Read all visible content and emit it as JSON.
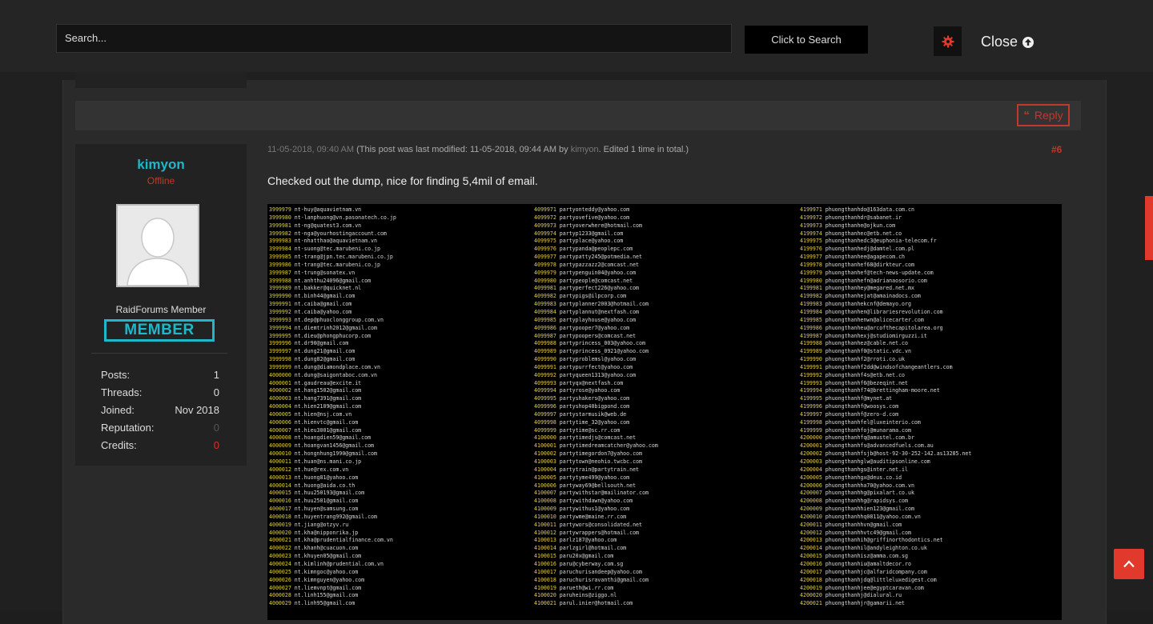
{
  "searchbar": {
    "placeholder": "Search...",
    "button_label": "Click to Search",
    "close_label": "Close"
  },
  "post": {
    "reply_label": "Reply",
    "timestamp": "11-05-2018, 09:40 AM",
    "modified_note": "(This post was last modified: 11-05-2018, 09:44 AM by",
    "modified_by": "kimyon",
    "edited_note": ". Edited 1 time in total.)",
    "number": "#6",
    "text": "Checked out the dump, nice for finding 5,4mil of email."
  },
  "user": {
    "name": "kimyon",
    "status": "Offline",
    "rank_title": "RaidForums Member",
    "rank_badge": "MEMBER",
    "stats": [
      {
        "label": "Posts:",
        "value": "1"
      },
      {
        "label": "Threads:",
        "value": "0"
      },
      {
        "label": "Joined:",
        "value": "Nov 2018"
      },
      {
        "label": "Reputation:",
        "value": "0"
      },
      {
        "label": "Credits:",
        "value": "0"
      }
    ]
  },
  "dump": {
    "columns": [
      [
        [
          "3999979",
          "nt-huy@aquavietnam.vn"
        ],
        [
          "3999980",
          "nt-lanphuong@vn.pasonatech.co.jp"
        ],
        [
          "3999981",
          "nt-ng@quatest3.com.vn"
        ],
        [
          "3999982",
          "nt-nga@yourhostingaccount.com"
        ],
        [
          "3999983",
          "nt-nhatthao@aquavietnam.vn"
        ],
        [
          "3999984",
          "nt-suong@tec.marubeni.co.jp"
        ],
        [
          "3999985",
          "nt-trang@jpn.tec.marubeni.co.jp"
        ],
        [
          "3999986",
          "nt-trang@tec.marubeni.co.jp"
        ],
        [
          "3999987",
          "nt-trung@sonatex.vn"
        ],
        [
          "3999988",
          "nt.anhthu24096@gmail.com"
        ],
        [
          "3999989",
          "nt.bakker@quicknet.nl"
        ],
        [
          "3999990",
          "nt.binh44@gmail.com"
        ],
        [
          "3999991",
          "nt.caiba@gmail.com"
        ],
        [
          "3999992",
          "nt.caiba@yahoo.com"
        ],
        [
          "3999993",
          "nt.dep@phuoclonggroup.com.vn"
        ],
        [
          "3999994",
          "nt.diemtrinh2012@gmail.com"
        ],
        [
          "3999995",
          "nt.dieu@phongphucorp.com"
        ],
        [
          "3999996",
          "nt.dr90@gmail.com"
        ],
        [
          "3999997",
          "nt.dung21@gmail.com"
        ],
        [
          "3999998",
          "nt.dung82@gmail.com"
        ],
        [
          "3999999",
          "nt.dung@diamondplace.com.vn"
        ],
        [
          "4000000",
          "nt.dung@saigontaboc.com.vn"
        ],
        [
          "4000001",
          "nt.gaudreau@excite.it"
        ],
        [
          "4000002",
          "nt.hang1502@gmail.com"
        ],
        [
          "4000003",
          "nt.hang7391@gmail.com"
        ],
        [
          "4000004",
          "nt.hien2109@gmail.com"
        ],
        [
          "4000005",
          "nt.hien@nsj.com.vn"
        ],
        [
          "4000006",
          "nt.hienvtc@gmail.com"
        ],
        [
          "4000007",
          "nt.hieu3001@gmail.com"
        ],
        [
          "4000008",
          "nt.hoangdien59@gmail.com"
        ],
        [
          "4000009",
          "nt.hoangvan1456@gmail.com"
        ],
        [
          "4000010",
          "nt.hongnhung1990@gmail.com"
        ],
        [
          "4000011",
          "nt.huan@ns.mani.co.jp"
        ],
        [
          "4000012",
          "nt.hue@rex.com.vn"
        ],
        [
          "4000013",
          "nt.huong81@yahoo.com"
        ],
        [
          "4000014",
          "nt.huong@aida.co.th"
        ],
        [
          "4000015",
          "nt.huu250193@gmail.com"
        ],
        [
          "4000016",
          "nt.huu2501@gmail.com"
        ],
        [
          "4000017",
          "nt.huyen@samsung.com"
        ],
        [
          "4000018",
          "nt.huyentrang992@gmail.com"
        ],
        [
          "4000019",
          "nt.jiang@otzyv.ru"
        ],
        [
          "4000020",
          "nt.kha@nipponrika.jp"
        ],
        [
          "4000021",
          "nt.kha@prudentialfinance.com.vn"
        ],
        [
          "4000022",
          "nt.khanh@cuacuon.com"
        ],
        [
          "4000023",
          "nt.khuyen05@gmail.com"
        ],
        [
          "4000024",
          "nt.kimlinh@prudential.com.vn"
        ],
        [
          "4000025",
          "nt.kimngoc@yahoo.com"
        ],
        [
          "4000026",
          "nt.kimnguyen@yahoo.com"
        ],
        [
          "4000027",
          "nt.liemvnpt@gmail.com"
        ],
        [
          "4000028",
          "nt.linh155@gmail.com"
        ],
        [
          "4000029",
          "nt.linh95@gmail.com"
        ]
      ],
      [
        [
          "4099971",
          "partyonteddy@yahoo.com"
        ],
        [
          "4099972",
          "partyovefive@yahoo.com"
        ],
        [
          "4099973",
          "partyoverwhere@hotmail.com"
        ],
        [
          "4099974",
          "partyp1233@gmail.com"
        ],
        [
          "4099975",
          "partyplace@yahoo.com"
        ],
        [
          "4099976",
          "partypanda@peoplepc.com"
        ],
        [
          "4099977",
          "partypatty245@potmedia.net"
        ],
        [
          "4099978",
          "partypazzazz2@comcast.net"
        ],
        [
          "4099979",
          "partypenguin04@yahoo.com"
        ],
        [
          "4099980",
          "partypeople@comcast.net"
        ],
        [
          "4099981",
          "partyperfect226@yahoo.com"
        ],
        [
          "4099982",
          "partypigs@ilpcorp.com"
        ],
        [
          "4099983",
          "partyplanner2003@hotmail.com"
        ],
        [
          "4099984",
          "partyplannut@nextfash.com"
        ],
        [
          "4099985",
          "partyplayhouse@yahoo.com"
        ],
        [
          "4099986",
          "partypooper7@yahoo.com"
        ],
        [
          "4099987",
          "partypoopers@comcast.net"
        ],
        [
          "4099988",
          "partyprincess_003@yahoo.com"
        ],
        [
          "4099989",
          "partyprincess_0921@yahoo.com"
        ],
        [
          "4099990",
          "partyproblemsl@yahoo.com"
        ],
        [
          "4099991",
          "partypurrfect@yahoo.com"
        ],
        [
          "4099992",
          "partyqueen1313@yahoo.com"
        ],
        [
          "4099993",
          "partyqx@nextfash.com"
        ],
        [
          "4099994",
          "partyrose@yahoo.com"
        ],
        [
          "4099995",
          "partyshakers@yahoo.com"
        ],
        [
          "4099996",
          "partyshop40bigpond.com"
        ],
        [
          "4099997",
          "partystarmusik@web.de"
        ],
        [
          "4099998",
          "partytime_32@yahoo.com"
        ],
        [
          "4099999",
          "partytime@sc.rr.com"
        ],
        [
          "4100000",
          "partytimedjs@comcast.net"
        ],
        [
          "4100001",
          "partytimedreamcatcher@yahoo.com"
        ],
        [
          "4100002",
          "partytimegordon7@yahoo.com"
        ],
        [
          "4100003",
          "partytown@neohio.twcbc.com"
        ],
        [
          "4100004",
          "partytrain@partytrain.net"
        ],
        [
          "4100005",
          "partytyme499@yahoo.com"
        ],
        [
          "4100006",
          "partyway69@bellsouth.net"
        ],
        [
          "4100007",
          "partywithstar@mailinator.com"
        ],
        [
          "4100008",
          "partywithdawn@yahoo.com"
        ],
        [
          "4100009",
          "partywithus1@yahoo.com"
        ],
        [
          "4100010",
          "partywme@maine.rr.com"
        ],
        [
          "4100011",
          "partywors@consolidated.net"
        ],
        [
          "4100012",
          "partywrappers@hotmail.com"
        ],
        [
          "4100013",
          "parlz187@yahoo.com"
        ],
        [
          "4100014",
          "parlzgirl@hotmail.com"
        ],
        [
          "4100015",
          "paru20x@gmail.com"
        ],
        [
          "4100016",
          "paru@cyberway.com.sg"
        ],
        [
          "4100017",
          "paruchurisandeep@yahoo.com"
        ],
        [
          "4100018",
          "paruchurisravanthi@gmail.com"
        ],
        [
          "4100019",
          "parueth@wi.rr.com"
        ],
        [
          "4100020",
          "paruheins@ziggo.nl"
        ],
        [
          "4100021",
          "parul.inier@hotmail.com"
        ]
      ],
      [
        [
          "4199971",
          "phuongthanhdo@163data.com.cn"
        ],
        [
          "4199972",
          "phuongthanhdr@sabanet.ir"
        ],
        [
          "4199973",
          "phuongthanhe@ojkun.com"
        ],
        [
          "4199974",
          "phuongthanhec@etb.net.co"
        ],
        [
          "4199975",
          "phuongthanhedc3@euphonia-telecom.fr"
        ],
        [
          "4199976",
          "phuongthanhedj@damtel.com.pl"
        ],
        [
          "4199977",
          "phuongthanhee@agapecom.ch"
        ],
        [
          "4199978",
          "phuongthanhef68@dirkteur.com"
        ],
        [
          "4199979",
          "phuongthanhef@tech-news-update.com"
        ],
        [
          "4199980",
          "phuongthanhefn@adrianaosorio.com"
        ],
        [
          "4199981",
          "phuongthanhey@megared.net.mx"
        ],
        [
          "4199982",
          "phuongthanhejat@amainadocs.com"
        ],
        [
          "4199983",
          "phuongthanhekcnf@demayo.org"
        ],
        [
          "4199984",
          "phuongthanhen@librariesrevolution.com"
        ],
        [
          "4199985",
          "phuongthanhenwn@alicecarter.com"
        ],
        [
          "4199986",
          "phuongthanheu@arcofthecapitolarea.org"
        ],
        [
          "4199987",
          "phuongthanhexj@studiomirguzzi.it"
        ],
        [
          "4199988",
          "phuongthanhez@cable.net.co"
        ],
        [
          "4199989",
          "phuongthanhf0@static.vdc.vn"
        ],
        [
          "4199990",
          "phuongthanhf2@rroti.co.uk"
        ],
        [
          "4199991",
          "phuongthanhf2dd@windsofchangeantlers.com"
        ],
        [
          "4199992",
          "phuongthanhf4s@etb.net.co"
        ],
        [
          "4199993",
          "phuongthanhf6@bezeqint.net"
        ],
        [
          "4199994",
          "phuongthanhf74@brettingham-moore.net"
        ],
        [
          "4199995",
          "phuongthanhf@mynet.at"
        ],
        [
          "4199996",
          "phuongthanhf@woosys.com"
        ],
        [
          "4199997",
          "phuongthanhf@zero-d.com"
        ],
        [
          "4199998",
          "phuongthanhfel@luxeinterio.com"
        ],
        [
          "4199999",
          "phuongthanhfoj@munarama.com"
        ],
        [
          "4200000",
          "phuongthanhfq@amustel.com.br"
        ],
        [
          "4200001",
          "phuongthanhfs@advancedfuels.com.au"
        ],
        [
          "4200002",
          "phuongthanhfsjb@host-92-30-252-142.as13285.net"
        ],
        [
          "4200003",
          "phuongthanhglw@auditipsonline.com"
        ],
        [
          "4200004",
          "phuongthanhgs@inter.net.il"
        ],
        [
          "4200005",
          "phuongthanhgx@deus.co.id"
        ],
        [
          "4200006",
          "phuongthanhha70@yahoo.com.vn"
        ],
        [
          "4200007",
          "phuongthanhhg@pixalart.co.uk"
        ],
        [
          "4200008",
          "phuongthanhhg@rapidsys.com"
        ],
        [
          "4200009",
          "phuongthanhhien123@gmail.com"
        ],
        [
          "4200010",
          "phuongthanhhq0811@yahoo.com.vn"
        ],
        [
          "4200011",
          "phuongthanhhvn@gmail.com"
        ],
        [
          "4200012",
          "phuongthanhhvtc49@gmail.com"
        ],
        [
          "4200013",
          "phuongthanhih@griffinorthodontics.net"
        ],
        [
          "4200014",
          "phuongthanhil@andyleighton.co.uk"
        ],
        [
          "4200015",
          "phuongthanhisz@amma.com.sg"
        ],
        [
          "4200016",
          "phuongthanhiu@amaltdecor.ro"
        ],
        [
          "4200017",
          "phuongthanhjc@alfaridcompany.com"
        ],
        [
          "4200018",
          "phuongthanhjdq@littleluxedigest.com"
        ],
        [
          "4200019",
          "phuongthanhjee@egyptcaravan.com"
        ],
        [
          "4200020",
          "phuongthanhj@dialural.ru"
        ],
        [
          "4200021",
          "phuongthanhjr@gamarii.net"
        ]
      ]
    ]
  }
}
